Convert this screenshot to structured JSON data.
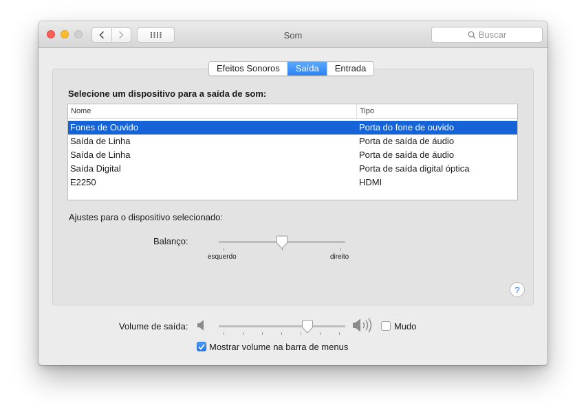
{
  "window": {
    "title": "Som",
    "search": {
      "placeholder": "Buscar",
      "icon": "search-icon"
    }
  },
  "tabs": [
    {
      "label": "Efeitos Sonoros",
      "active": false
    },
    {
      "label": "Saída",
      "active": true
    },
    {
      "label": "Entrada",
      "active": false
    }
  ],
  "output": {
    "section_title": "Selecione um dispositivo para a saída de som:",
    "columns": [
      "Nome",
      "Tipo"
    ],
    "devices": [
      {
        "name": "Fones de Ouvido",
        "type": "Porta do fone de ouvido",
        "selected": true
      },
      {
        "name": "Saída de Linha",
        "type": "Porta de saída de áudio",
        "selected": false
      },
      {
        "name": "Saída de Linha",
        "type": "Porta de saída de áudio",
        "selected": false
      },
      {
        "name": "Saída Digital",
        "type": "Porta de saída digital óptica",
        "selected": false
      },
      {
        "name": "E2250",
        "type": "HDMI",
        "selected": false
      }
    ],
    "adjust_label": "Ajustes para o dispositivo selecionado:",
    "balance": {
      "label": "Balanço:",
      "left_label": "esquerdo",
      "right_label": "direito",
      "value": 0.5
    }
  },
  "help_glyph": "?",
  "volume": {
    "label": "Volume de saída:",
    "value": 0.72,
    "mute_label": "Mudo",
    "muted": false,
    "show_in_menu_label": "Mostrar volume na barra de menus",
    "show_in_menu": true
  },
  "colors": {
    "selection": "#1663d8",
    "tab_active": "#2c82f0",
    "close": "#fc5f57",
    "minimize": "#fdbc2e"
  }
}
